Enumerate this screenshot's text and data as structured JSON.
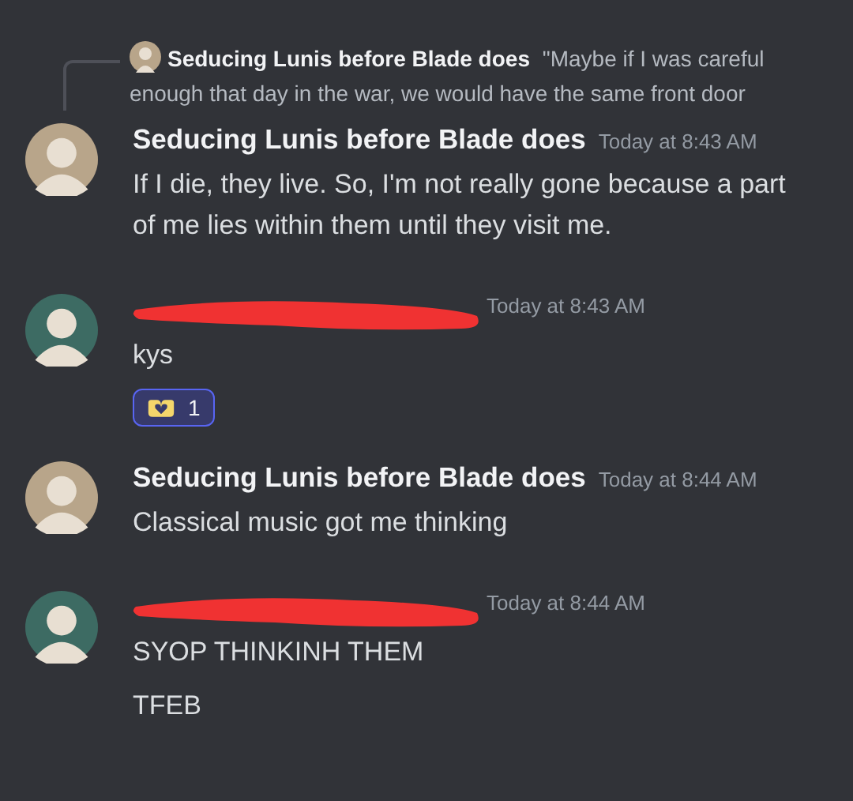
{
  "messages": [
    {
      "reply": {
        "author": "Seducing Lunis before Blade does",
        "text": "\"Maybe if I was careful enough that day in the war, we would have the same front door"
      },
      "author": "Seducing Lunis before Blade does",
      "author_redacted": false,
      "avatar": {
        "color": "#b8a58a"
      },
      "time": "Today at 8:43 AM",
      "lines": [
        "If I die, they live. So, I'm not really gone because a part of me lies within them until they visit me."
      ]
    },
    {
      "author_redacted": true,
      "avatar": {
        "color": "#3d6b63"
      },
      "time": "Today at 8:43 AM",
      "lines": [
        "kys"
      ],
      "reactions": [
        {
          "count": "1",
          "selected": true
        }
      ]
    },
    {
      "author": "Seducing Lunis before Blade does",
      "author_redacted": false,
      "avatar": {
        "color": "#b8a58a"
      },
      "time": "Today at 8:44 AM",
      "lines": [
        "Classical music got me thinking"
      ]
    },
    {
      "author_redacted": true,
      "avatar": {
        "color": "#3d6b63"
      },
      "time": "Today at 8:44 AM",
      "lines": [
        "SYOP THINKINH THEM",
        "TFEB"
      ]
    }
  ]
}
